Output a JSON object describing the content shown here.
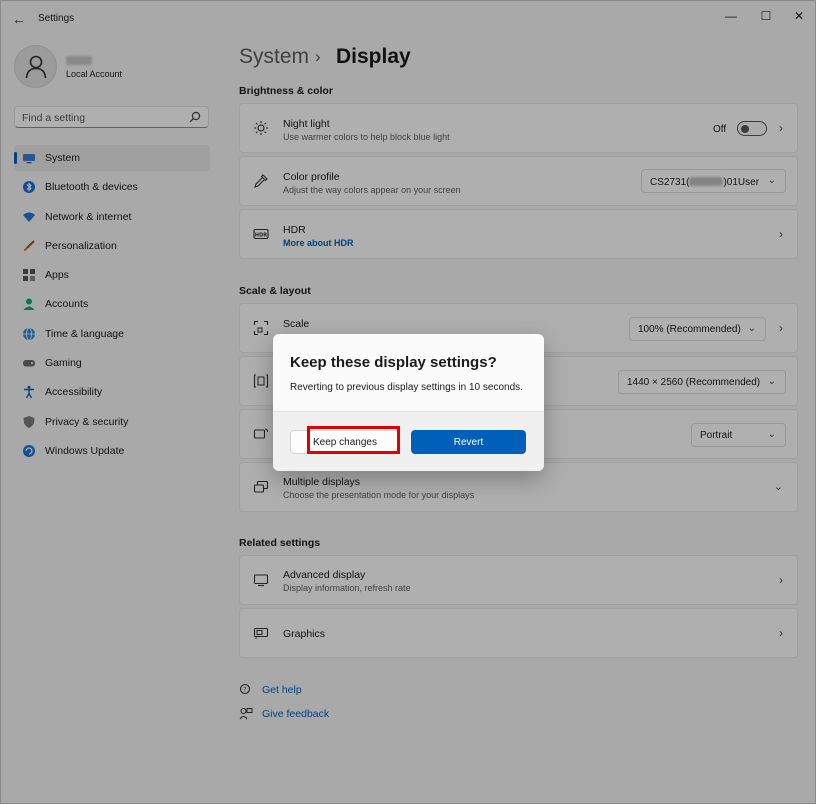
{
  "window": {
    "app_title": "Settings",
    "back_glyph": "←",
    "minimize_glyph": "—",
    "maximize_glyph": "☐",
    "close_glyph": "✕"
  },
  "profile": {
    "account_type": "Local Account",
    "avatar_icon": "person-icon"
  },
  "search": {
    "placeholder": "Find a setting",
    "icon": "search-icon"
  },
  "sidebar": {
    "items": [
      {
        "label": "System",
        "icon": "monitor-icon",
        "active": true
      },
      {
        "label": "Bluetooth & devices",
        "icon": "bluetooth-icon"
      },
      {
        "label": "Network & internet",
        "icon": "wifi-icon"
      },
      {
        "label": "Personalization",
        "icon": "brush-icon"
      },
      {
        "label": "Apps",
        "icon": "apps-icon"
      },
      {
        "label": "Accounts",
        "icon": "account-icon"
      },
      {
        "label": "Time & language",
        "icon": "globe-icon"
      },
      {
        "label": "Gaming",
        "icon": "controller-icon"
      },
      {
        "label": "Accessibility",
        "icon": "accessibility-icon"
      },
      {
        "label": "Privacy & security",
        "icon": "shield-icon"
      },
      {
        "label": "Windows Update",
        "icon": "update-icon"
      }
    ]
  },
  "header": {
    "parent": "System",
    "separator": "›",
    "title": "Display"
  },
  "brightness_color": {
    "section_title": "Brightness & color",
    "night_light": {
      "title": "Night light",
      "subtitle": "Use warmer colors to help block blue light",
      "toggle_state": "Off"
    },
    "color_profile": {
      "title": "Color profile",
      "subtitle": "Adjust the way colors appear on your screen",
      "value_prefix": "CS2731(",
      "value_suffix": ")01User"
    },
    "hdr": {
      "title": "HDR",
      "link": "More about HDR"
    }
  },
  "scale_layout": {
    "section_title": "Scale & layout",
    "scale": {
      "title": "Scale",
      "value": "100% (Recommended)"
    },
    "resolution": {
      "value": "1440 × 2560 (Recommended)"
    },
    "orientation": {
      "value": "Portrait"
    },
    "multiple_displays": {
      "title": "Multiple displays",
      "subtitle": "Choose the presentation mode for your displays"
    }
  },
  "related": {
    "section_title": "Related settings",
    "advanced_display": {
      "title": "Advanced display",
      "subtitle": "Display information, refresh rate"
    },
    "graphics": {
      "title": "Graphics"
    }
  },
  "footer": {
    "get_help": "Get help",
    "give_feedback": "Give feedback"
  },
  "dialog": {
    "title": "Keep these display settings?",
    "message": "Reverting to previous display settings in 10 seconds.",
    "keep_label": "Keep changes",
    "revert_label": "Revert"
  },
  "colors": {
    "accent": "#005fb8",
    "highlight": "#e00000",
    "background": "#f3f3f3"
  }
}
